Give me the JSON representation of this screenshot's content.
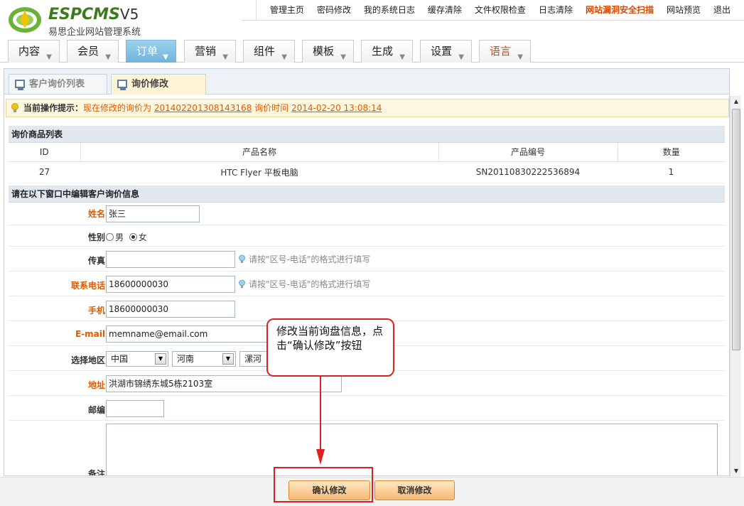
{
  "header": {
    "logo_text": "ESPCMS",
    "logo_version": "V5",
    "subtitle": "易思企业网站管理系统",
    "top_links": [
      "管理主页",
      "密码修改",
      "我的系统日志",
      "缓存清除",
      "文件权限检查",
      "日志清除",
      "网站漏洞安全扫描",
      "网站预览",
      "退出"
    ]
  },
  "main_menu": {
    "items": [
      "内容",
      "会员",
      "订单",
      "营销",
      "组件",
      "模板",
      "生成",
      "设置",
      "语言"
    ],
    "active": "订单"
  },
  "tabs": {
    "list_label": "客户询价列表",
    "edit_label": "询价修改"
  },
  "notice": {
    "prefix": "当前操作提示：",
    "text1": "现在修改的询价为",
    "order_no": "201402201308143168",
    "text2": "询价时间",
    "time": "2014-02-20 13:08:14"
  },
  "goods": {
    "title": "询价商品列表",
    "columns": [
      "ID",
      "产品名称",
      "产品编号",
      "数量"
    ],
    "rows": [
      [
        "27",
        "HTC Flyer 平板电脑",
        "SN20110830222536894",
        "1"
      ]
    ]
  },
  "form": {
    "title": "请在以下窗口中编辑客户询价信息",
    "name_label": "姓名",
    "name_value": "张三",
    "gender_label": "性别",
    "gender_male": "男",
    "gender_female": "女",
    "fax_label": "传真",
    "fax_value": "",
    "fax_hint": "请按\"区号-电话\"的格式进行填写",
    "phone_label": "联系电话",
    "phone_value": "18600000030",
    "phone_hint": "请按\"区号-电话\"的格式进行填写",
    "mobile_label": "手机",
    "mobile_value": "18600000030",
    "email_label": "E-mail",
    "email_value": "memname@email.com",
    "region_label": "选择地区",
    "region_country": "中国",
    "region_province": "河南",
    "region_city": "漯河",
    "address_label": "地址",
    "address_value": "洪湖市锦绣东城5栋2103室",
    "zip_label": "邮编",
    "zip_value": "",
    "remark_label": "备注"
  },
  "buttons": {
    "confirm": "确认修改",
    "cancel": "取消修改"
  },
  "callout": {
    "text": "修改当前询盘信息，点击“确认修改”按钮"
  }
}
